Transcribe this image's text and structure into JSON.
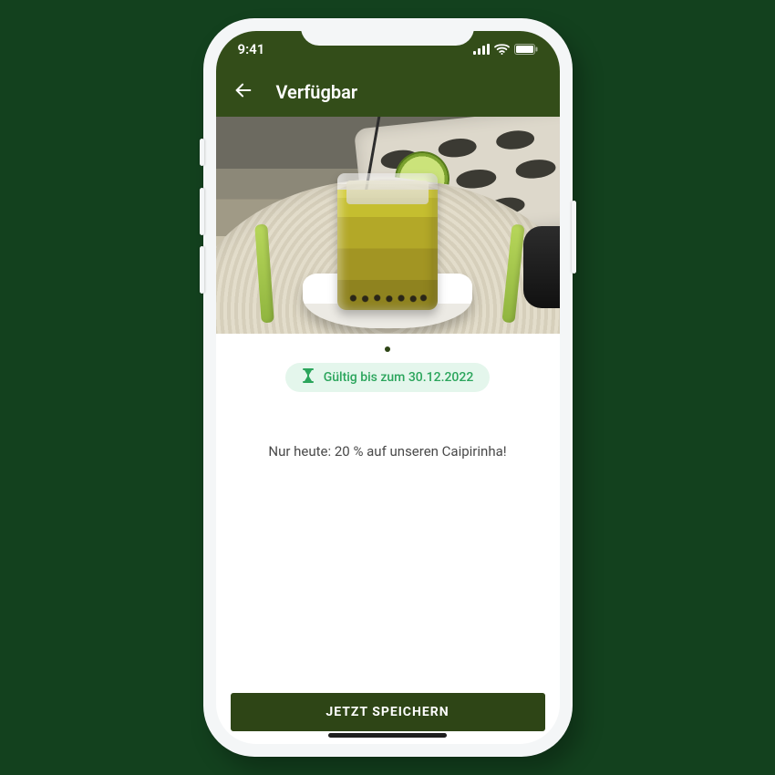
{
  "statusbar": {
    "time": "9:41"
  },
  "header": {
    "title": "Verfügbar"
  },
  "hero": {
    "illustration": "caipirinha-cocktail"
  },
  "validity": {
    "label": "Gültig bis zum 30.12.2022"
  },
  "offer": {
    "text": "Nur heute: 20 % auf unseren Caipirinha!"
  },
  "cta": {
    "label": "JETZT SPEICHERN"
  },
  "colors": {
    "olive": "#334d19",
    "green_accent": "#2ba55c",
    "green_pill_bg": "#e4f6ec",
    "page_bg": "#13411e"
  }
}
